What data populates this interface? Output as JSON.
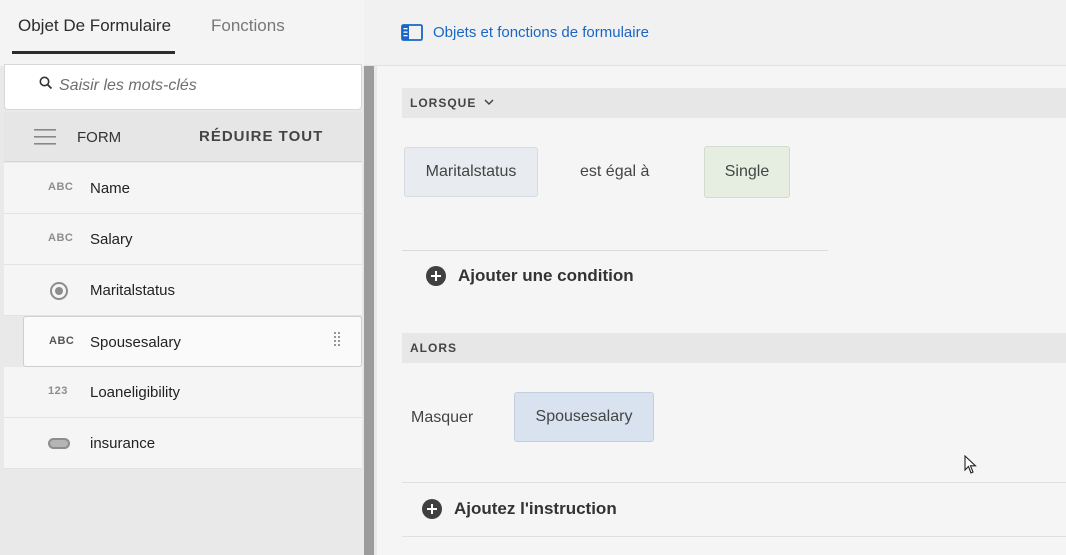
{
  "tabs": {
    "form_objects": "Objet De Formulaire",
    "functions": "Fonctions"
  },
  "search": {
    "placeholder": "Saisir les mots-clés"
  },
  "tree_header": {
    "form_label": "FORM",
    "collapse_all": "RÉDUIRE TOUT"
  },
  "tree_items": [
    {
      "type": "ABC",
      "label": "Name"
    },
    {
      "type": "ABC",
      "label": "Salary"
    },
    {
      "type": "radio",
      "label": "Maritalstatus"
    },
    {
      "type": "ABC",
      "label": "Spousesalary",
      "selected": true
    },
    {
      "type": "123",
      "label": "Loaneligibility"
    },
    {
      "type": "toggle",
      "label": "insurance"
    }
  ],
  "topbar": {
    "title": "Objets et fonctions de formulaire",
    "accent": "#1a66c4"
  },
  "rule": {
    "when_label": "LORSQUE",
    "condition": {
      "field": "Maritalstatus",
      "operator": "est égal à",
      "value": "Single"
    },
    "add_condition": "Ajouter une condition",
    "then_label": "ALORS",
    "action": {
      "verb": "Masquer",
      "target": "Spousesalary"
    },
    "add_statement": "Ajoutez l'instruction"
  }
}
